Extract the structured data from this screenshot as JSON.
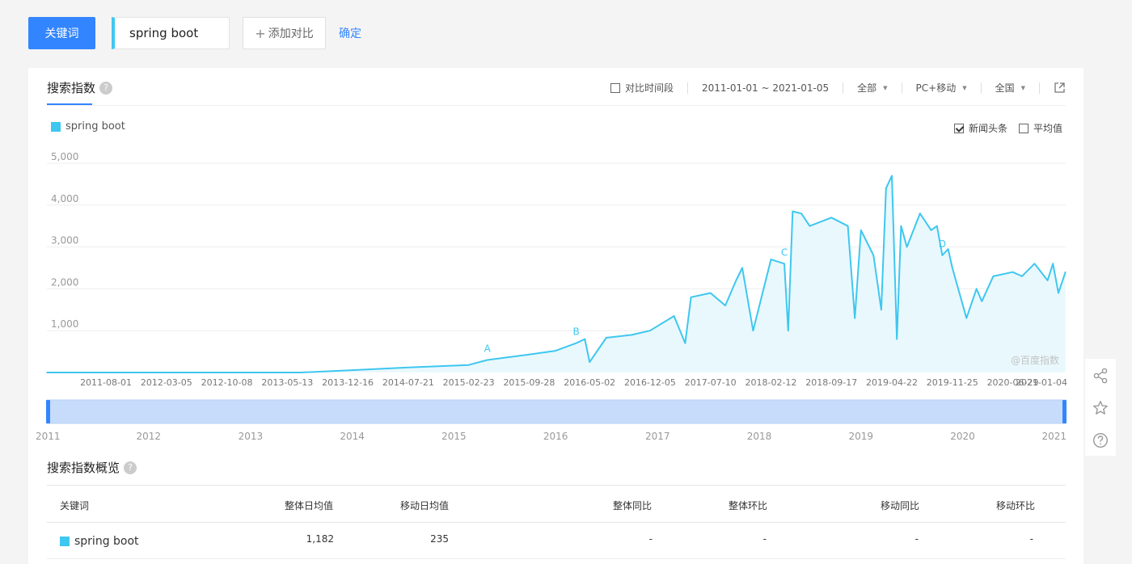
{
  "toolbar": {
    "keyword_button": "关键词",
    "keyword_value": "spring boot",
    "add_compare_plus": "+",
    "add_compare_label": "添加对比",
    "confirm_label": "确定"
  },
  "panel": {
    "title": "搜索指数",
    "help_glyph": "?",
    "filters": {
      "compare_period_label": "对比时间段",
      "compare_period_checked": false,
      "date_range": "2011-01-01 ~ 2021-01-05",
      "source": "全部",
      "device": "PC+移动",
      "region": "全国"
    },
    "legend_label": "spring boot",
    "news_headlines_label": "新闻头条",
    "news_headlines_checked": true,
    "average_label": "平均值",
    "average_checked": false,
    "watermark": "@百度指数"
  },
  "colors": {
    "accent": "#3385ff",
    "series": "#3ec7f0"
  },
  "chart_data": {
    "type": "area",
    "series": [
      {
        "name": "spring boot",
        "x": [
          "2011-01-01",
          "2013-07-01",
          "2013-12-16",
          "2014-07-21",
          "2015-02-23",
          "2015-05-01",
          "2015-09-28",
          "2016-01-01",
          "2016-03-15",
          "2016-04-15",
          "2016-05-02",
          "2016-07-01",
          "2016-10-01",
          "2016-12-05",
          "2017-03-01",
          "2017-04-10",
          "2017-05-01",
          "2017-07-10",
          "2017-09-01",
          "2017-10-10",
          "2017-11-01",
          "2017-12-10",
          "2018-02-12",
          "2018-04-01",
          "2018-04-15",
          "2018-05-01",
          "2018-06-01",
          "2018-07-01",
          "2018-09-17",
          "2018-11-15",
          "2018-12-10",
          "2019-01-01",
          "2019-02-15",
          "2019-03-15",
          "2019-04-01",
          "2019-04-22",
          "2019-05-10",
          "2019-05-25",
          "2019-06-15",
          "2019-08-01",
          "2019-09-10",
          "2019-10-01",
          "2019-10-20",
          "2019-11-10",
          "2019-11-25",
          "2020-01-15",
          "2020-02-20",
          "2020-03-10",
          "2020-04-20",
          "2020-06-29",
          "2020-08-01",
          "2020-09-15",
          "2020-11-01",
          "2020-11-20",
          "2020-12-10",
          "2021-01-04"
        ],
        "y": [
          0,
          0,
          50,
          120,
          180,
          300,
          430,
          520,
          700,
          800,
          250,
          830,
          900,
          1000,
          1350,
          700,
          1800,
          1900,
          1600,
          2200,
          2500,
          1000,
          2700,
          2600,
          1000,
          3850,
          3800,
          3500,
          3700,
          3500,
          1300,
          3400,
          2800,
          1500,
          4400,
          4700,
          800,
          3500,
          3000,
          3800,
          3400,
          3500,
          2800,
          2950,
          2500,
          1300,
          2000,
          1700,
          2300,
          2400,
          2300,
          2600,
          2200,
          2600,
          1900,
          2400
        ]
      }
    ],
    "x_tick_labels": [
      "2011-08-01",
      "2012-03-05",
      "2012-10-08",
      "2013-05-13",
      "2013-12-16",
      "2014-07-21",
      "2015-02-23",
      "2015-09-28",
      "2016-05-02",
      "2016-12-05",
      "2017-07-10",
      "2018-02-12",
      "2018-09-17",
      "2019-04-22",
      "2019-11-25",
      "2020-06-29",
      "2021-01-04"
    ],
    "y_tick_labels": [
      "5,000",
      "4,000",
      "3,000",
      "2,000",
      "1,000"
    ],
    "ylim": [
      0,
      5000
    ],
    "annotations": [
      {
        "label": "A",
        "x": "2015-05-01"
      },
      {
        "label": "B",
        "x": "2016-03-15"
      },
      {
        "label": "C",
        "x": "2018-04-01"
      },
      {
        "label": "D",
        "x": "2019-10-20"
      }
    ],
    "grid": true,
    "legend_position": "top-left"
  },
  "timeline_years": [
    "2011",
    "2012",
    "2013",
    "2014",
    "2015",
    "2016",
    "2017",
    "2018",
    "2019",
    "2020",
    "2021"
  ],
  "overview": {
    "title": "搜索指数概览",
    "help_glyph": "?",
    "headers": [
      "关键词",
      "整体日均值",
      "移动日均值",
      "整体同比",
      "整体环比",
      "移动同比",
      "移动环比"
    ],
    "rows": [
      {
        "keyword": "spring boot",
        "overall_avg": "1,182",
        "mobile_avg": "235",
        "overall_yoy": "-",
        "overall_mom": "-",
        "mobile_yoy": "-",
        "mobile_mom": "-"
      }
    ]
  },
  "side_tools": [
    "share-icon",
    "star-icon",
    "help-icon"
  ]
}
